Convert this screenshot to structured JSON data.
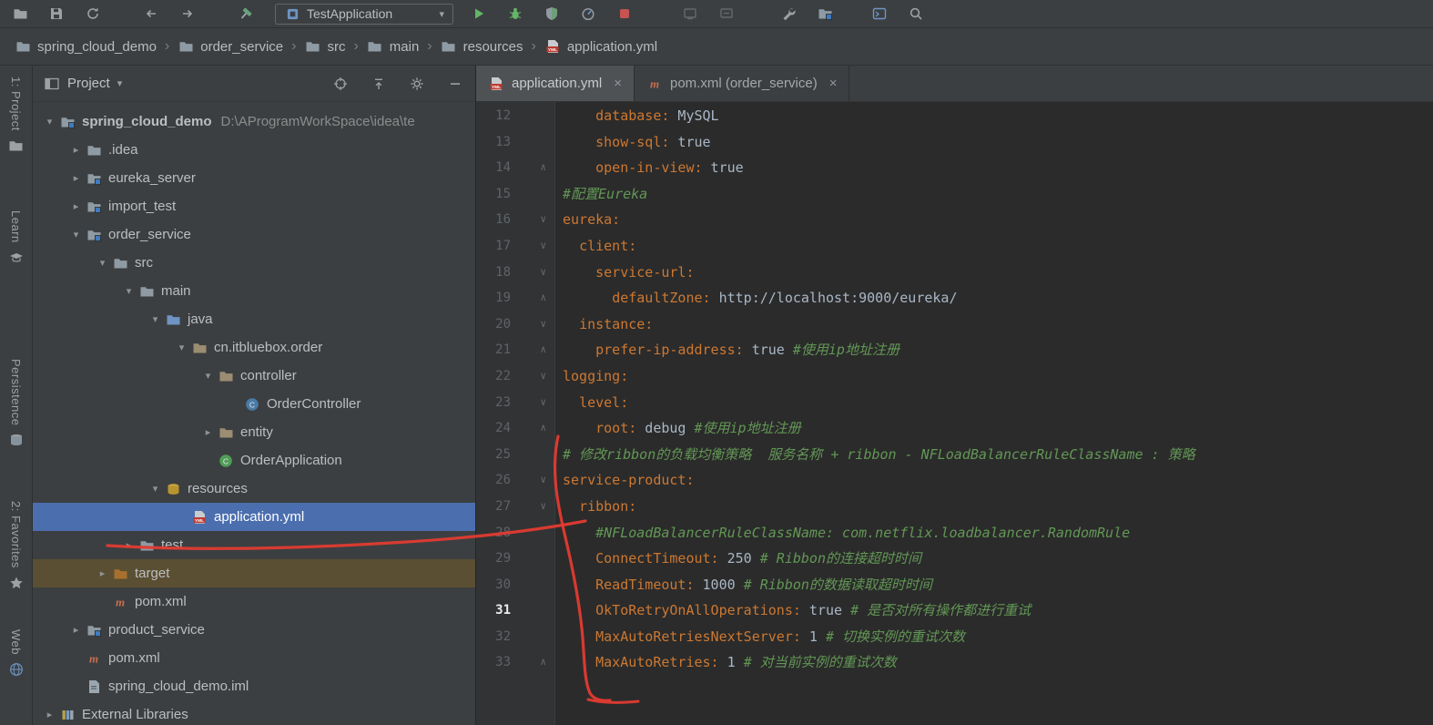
{
  "app": {
    "selection_color": "#4b6eaf",
    "annotation_color": "#e23b32"
  },
  "toolbar": {
    "run_config": {
      "label": "TestApplication",
      "caret": "▾"
    },
    "buttons": [
      "open-project",
      "save-all",
      "synchronize",
      "back",
      "forward",
      "build-hammer",
      "run",
      "debug",
      "coverage",
      "profiler",
      "stop",
      "attach-1",
      "attach-2",
      "settings-wrench",
      "show-module",
      "terminal",
      "search-everywhere"
    ]
  },
  "breadcrumbs": {
    "separator": "›",
    "items": [
      {
        "label": "spring_cloud_demo",
        "icon": "folder"
      },
      {
        "label": "order_service",
        "icon": "folder"
      },
      {
        "label": "src",
        "icon": "folder"
      },
      {
        "label": "main",
        "icon": "folder"
      },
      {
        "label": "resources",
        "icon": "folder"
      },
      {
        "label": "application.yml",
        "icon": "yml"
      }
    ]
  },
  "tool_stripe": {
    "items": [
      {
        "label": "1: Project",
        "icon": "project-tool"
      },
      {
        "label": "Learn",
        "icon": "learn"
      },
      {
        "label": "Persistence",
        "icon": "persistence"
      },
      {
        "label": "2: Favorites",
        "icon": "favorites"
      },
      {
        "label": "Web",
        "icon": "web"
      }
    ]
  },
  "project_panel": {
    "title": "Project",
    "caret": "▾",
    "header_icons": [
      "locate",
      "collapse-all",
      "settings",
      "hide"
    ],
    "arrow_glyphs": {
      "v": "▾",
      ">": "▸"
    },
    "tree": [
      {
        "label": "spring_cloud_demo",
        "suffix": "D:\\AProgramWorkSpace\\idea\\te",
        "level": 0,
        "arrow": "v",
        "icon": "project",
        "bold": true
      },
      {
        "label": ".idea",
        "level": 1,
        "arrow": ">",
        "icon": "folder"
      },
      {
        "label": "eureka_server",
        "level": 1,
        "arrow": ">",
        "icon": "module"
      },
      {
        "label": "import_test",
        "level": 1,
        "arrow": ">",
        "icon": "module"
      },
      {
        "label": "order_service",
        "level": 1,
        "arrow": "v",
        "icon": "module"
      },
      {
        "label": "src",
        "level": 2,
        "arrow": "v",
        "icon": "folder"
      },
      {
        "label": "main",
        "level": 3,
        "arrow": "v",
        "icon": "folder"
      },
      {
        "label": "java",
        "level": 4,
        "arrow": "v",
        "icon": "src"
      },
      {
        "label": "cn.itbluebox.order",
        "level": 5,
        "arrow": "v",
        "icon": "package"
      },
      {
        "label": "controller",
        "level": 6,
        "arrow": "v",
        "icon": "package"
      },
      {
        "label": "OrderController",
        "level": 7,
        "arrow": null,
        "icon": "class"
      },
      {
        "label": "entity",
        "level": 6,
        "arrow": ">",
        "icon": "package"
      },
      {
        "label": "OrderApplication",
        "level": 6,
        "arrow": null,
        "icon": "main-class"
      },
      {
        "label": "resources",
        "level": 4,
        "arrow": "v",
        "icon": "resources"
      },
      {
        "label": "application.yml",
        "level": 5,
        "arrow": null,
        "icon": "yml",
        "selected": true
      },
      {
        "label": "test",
        "level": 3,
        "arrow": ">",
        "icon": "folder"
      },
      {
        "label": "target",
        "level": 2,
        "arrow": ">",
        "icon": "excluded",
        "excluded": true
      },
      {
        "label": "pom.xml",
        "level": 2,
        "arrow": null,
        "icon": "maven"
      },
      {
        "label": "product_service",
        "level": 1,
        "arrow": ">",
        "icon": "module"
      },
      {
        "label": "pom.xml",
        "level": 1,
        "arrow": null,
        "icon": "maven"
      },
      {
        "label": "spring_cloud_demo.iml",
        "level": 1,
        "arrow": null,
        "icon": "iml"
      },
      {
        "label": "External Libraries",
        "level": 0,
        "arrow": ">",
        "icon": "lib"
      }
    ]
  },
  "editor": {
    "close_glyph": "×",
    "fold_glyphs": {
      "d": "∨",
      "u": "∧"
    },
    "tabs": [
      {
        "label": "application.yml",
        "icon": "yml",
        "active": true
      },
      {
        "label": "pom.xml (order_service)",
        "icon": "maven",
        "active": false
      }
    ],
    "lines": [
      {
        "n": 12,
        "f": null,
        "t": [
          [
            "    ",
            "p"
          ],
          [
            "database:",
            "k"
          ],
          [
            " MySQL",
            "v"
          ]
        ]
      },
      {
        "n": 13,
        "f": null,
        "t": [
          [
            "    ",
            "p"
          ],
          [
            "show-sql:",
            "k"
          ],
          [
            " true",
            "v"
          ]
        ]
      },
      {
        "n": 14,
        "f": "u",
        "t": [
          [
            "    ",
            "p"
          ],
          [
            "open-in-view:",
            "k"
          ],
          [
            " true",
            "v"
          ]
        ]
      },
      {
        "n": 15,
        "f": null,
        "t": [
          [
            "#配置Eureka",
            "c"
          ]
        ]
      },
      {
        "n": 16,
        "f": "d",
        "t": [
          [
            "eureka:",
            "k"
          ]
        ]
      },
      {
        "n": 17,
        "f": "d",
        "t": [
          [
            "  ",
            "p"
          ],
          [
            "client:",
            "k"
          ]
        ]
      },
      {
        "n": 18,
        "f": "d",
        "t": [
          [
            "    ",
            "p"
          ],
          [
            "service-url:",
            "k"
          ]
        ]
      },
      {
        "n": 19,
        "f": "u",
        "t": [
          [
            "      ",
            "p"
          ],
          [
            "defaultZone:",
            "k"
          ],
          [
            " http://localhost:9000/eureka/",
            "v"
          ]
        ]
      },
      {
        "n": 20,
        "f": "d",
        "t": [
          [
            "  ",
            "p"
          ],
          [
            "instance:",
            "k"
          ]
        ]
      },
      {
        "n": 21,
        "f": "u",
        "t": [
          [
            "    ",
            "p"
          ],
          [
            "prefer-ip-address:",
            "k"
          ],
          [
            " true ",
            "v"
          ],
          [
            "#使用ip地址注册",
            "c"
          ]
        ]
      },
      {
        "n": 22,
        "f": "d",
        "t": [
          [
            "logging:",
            "k"
          ]
        ]
      },
      {
        "n": 23,
        "f": "d",
        "t": [
          [
            "  ",
            "p"
          ],
          [
            "level:",
            "k"
          ]
        ]
      },
      {
        "n": 24,
        "f": "u",
        "t": [
          [
            "    ",
            "p"
          ],
          [
            "root:",
            "k"
          ],
          [
            " debug ",
            "v"
          ],
          [
            "#使用ip地址注册",
            "c"
          ]
        ]
      },
      {
        "n": 25,
        "f": null,
        "t": [
          [
            "# 修改ribbon的负载均衡策略  服务名称 + ribbon - NFLoadBalancerRuleClassName : 策略",
            "c"
          ]
        ]
      },
      {
        "n": 26,
        "f": "d",
        "t": [
          [
            "service-product:",
            "k"
          ]
        ]
      },
      {
        "n": 27,
        "f": "d",
        "t": [
          [
            "  ",
            "p"
          ],
          [
            "ribbon:",
            "k"
          ]
        ]
      },
      {
        "n": 28,
        "f": null,
        "t": [
          [
            "    ",
            "p"
          ],
          [
            "#NFLoadBalancerRuleClassName: com.netflix.loadbalancer.RandomRule",
            "c"
          ]
        ]
      },
      {
        "n": 29,
        "f": null,
        "t": [
          [
            "    ",
            "p"
          ],
          [
            "ConnectTimeout:",
            "k"
          ],
          [
            " 250 ",
            "v"
          ],
          [
            "# Ribbon的连接超时时间",
            "c"
          ]
        ]
      },
      {
        "n": 30,
        "f": null,
        "t": [
          [
            "    ",
            "p"
          ],
          [
            "ReadTimeout:",
            "k"
          ],
          [
            " 1000 ",
            "v"
          ],
          [
            "# Ribbon的数据读取超时时间",
            "c"
          ]
        ]
      },
      {
        "n": 31,
        "f": null,
        "caret": true,
        "t": [
          [
            "    ",
            "p"
          ],
          [
            "OkToRetryOnAllOperations:",
            "k"
          ],
          [
            " true ",
            "v"
          ],
          [
            "# 是否对所有操作都进行重试",
            "c"
          ]
        ]
      },
      {
        "n": 32,
        "f": null,
        "t": [
          [
            "    ",
            "p"
          ],
          [
            "MaxAutoRetriesNextServer:",
            "k"
          ],
          [
            " 1 ",
            "v"
          ],
          [
            "# 切换实例的重试次数",
            "c"
          ]
        ]
      },
      {
        "n": 33,
        "f": "u",
        "t": [
          [
            "    ",
            "p"
          ],
          [
            "MaxAutoRetries:",
            "k"
          ],
          [
            " 1 ",
            "v"
          ],
          [
            "# 对当前实例的重试次数",
            "c"
          ]
        ]
      }
    ]
  },
  "annotations": {
    "color": "#e23b32",
    "marks": [
      "hand-drawn underline from application.yml tree item into editor",
      "hand-drawn vertical line along ribbon settings lines 25-33"
    ]
  }
}
